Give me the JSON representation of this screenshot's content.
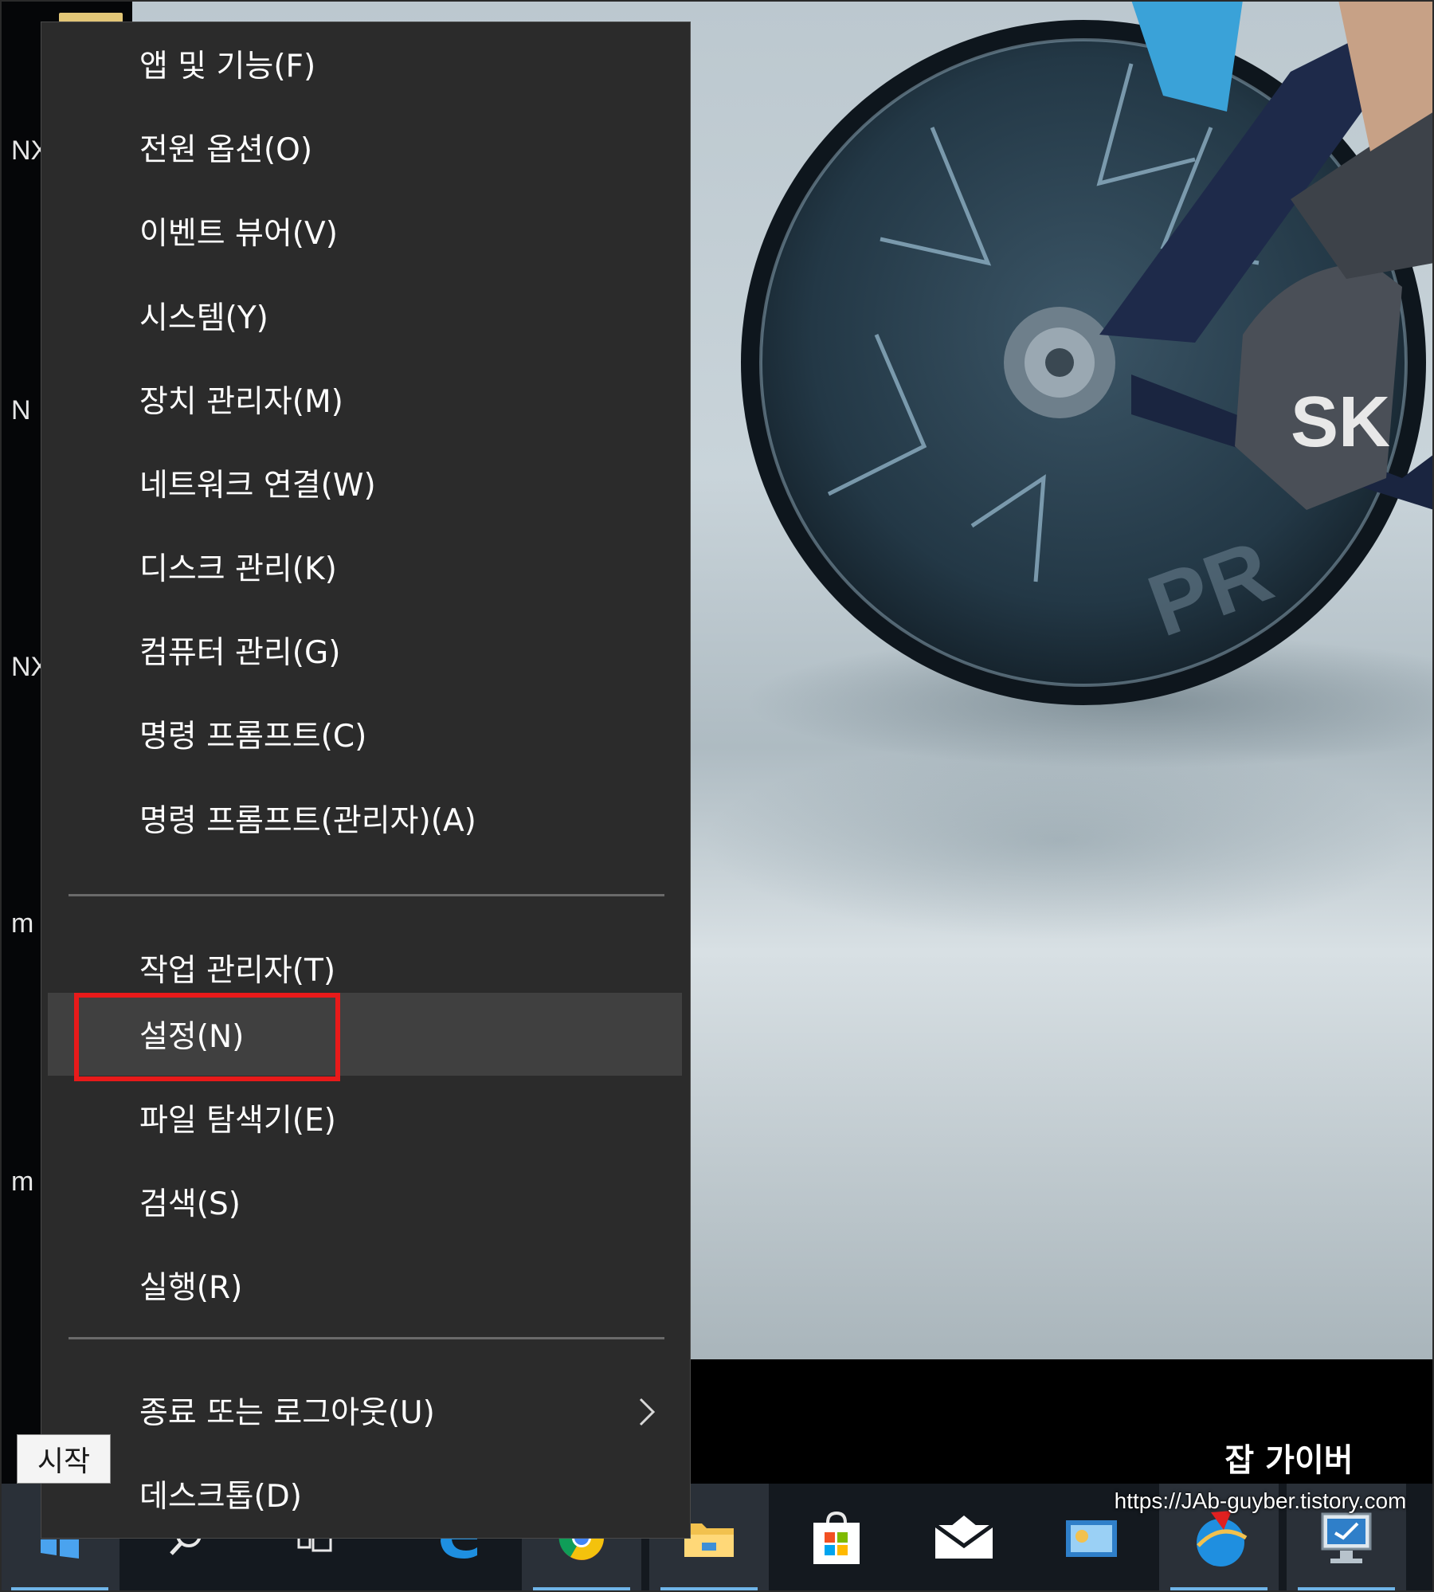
{
  "menu": {
    "items": [
      {
        "label": "앱 및 기능(F)"
      },
      {
        "label": "전원 옵션(O)"
      },
      {
        "label": "이벤트 뷰어(V)"
      },
      {
        "label": "시스템(Y)"
      },
      {
        "label": "장치 관리자(M)"
      },
      {
        "label": "네트워크 연결(W)"
      },
      {
        "label": "디스크 관리(K)"
      },
      {
        "label": "컴퓨터 관리(G)"
      },
      {
        "label": "명령 프롬프트(C)"
      },
      {
        "label": "명령 프롬프트(관리자)(A)"
      },
      {
        "label": "작업 관리자(T)"
      },
      {
        "label": "설정(N)",
        "highlighted": true
      },
      {
        "label": "파일 탐색기(E)"
      },
      {
        "label": "검색(S)"
      },
      {
        "label": "실행(R)"
      },
      {
        "label": "종료 또는 로그아웃(U)",
        "has_submenu": true
      },
      {
        "label": "데스크톱(D)"
      }
    ],
    "submenu_icon": "chevron-right-icon",
    "highlight_color": "#e81a1a"
  },
  "tooltip": {
    "start": "시작"
  },
  "desktop": {
    "icon_stubs": [
      "NX",
      "N",
      "NX",
      "m",
      "m"
    ]
  },
  "taskbar": {
    "items": [
      {
        "icon": "windows-start-icon",
        "active": true
      },
      {
        "icon": "search-icon"
      },
      {
        "icon": "task-view-icon"
      },
      {
        "icon": "edge-icon"
      },
      {
        "icon": "chrome-icon",
        "active": true
      },
      {
        "icon": "file-explorer-icon",
        "active": true
      },
      {
        "icon": "store-icon"
      },
      {
        "icon": "mail-icon"
      },
      {
        "icon": "app-icon"
      },
      {
        "icon": "globe-app-icon",
        "active": true
      },
      {
        "icon": "monitor-app-icon",
        "active": true
      }
    ]
  },
  "watermark": {
    "title": "잡 가이버",
    "url": "https://JAb-guyber.tistory.com"
  },
  "colors": {
    "menu_bg": "#2b2b2b",
    "menu_hover": "#404040",
    "taskbar_bg": "#14191f",
    "accent_underline": "#6fb4e8"
  }
}
